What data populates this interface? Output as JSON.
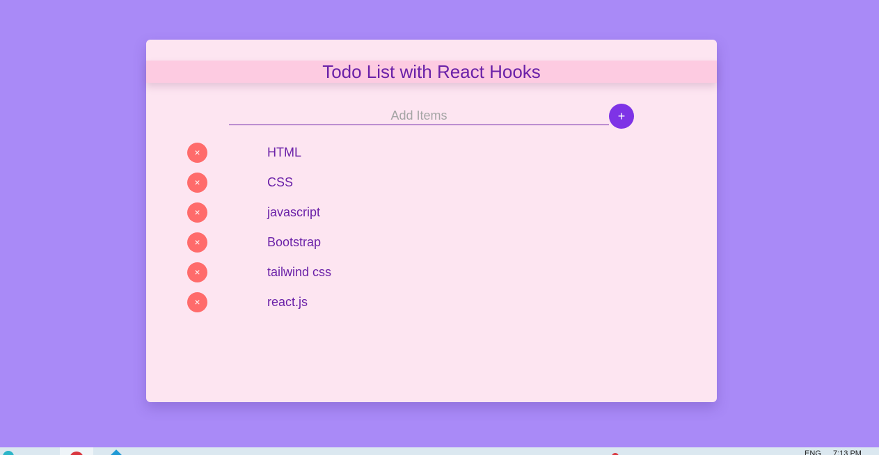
{
  "app": {
    "title": "Todo List with React Hooks"
  },
  "add_form": {
    "placeholder": "Add Items",
    "add_button_label": "+"
  },
  "items": [
    {
      "text": "HTML",
      "delete_label": "×"
    },
    {
      "text": "CSS",
      "delete_label": "×"
    },
    {
      "text": "javascript",
      "delete_label": "×"
    },
    {
      "text": "Bootstrap",
      "delete_label": "×"
    },
    {
      "text": "tailwind css",
      "delete_label": "×"
    },
    {
      "text": "react.js",
      "delete_label": "×"
    }
  ],
  "taskbar": {
    "language": "ENG",
    "time": "7:13 PM"
  },
  "colors": {
    "background": "#a98af7",
    "card": "#fde5f1",
    "title_bar": "#fdcbe1",
    "accent": "#7e33e6",
    "delete": "#ff6b6b",
    "text": "#6b21a8"
  }
}
